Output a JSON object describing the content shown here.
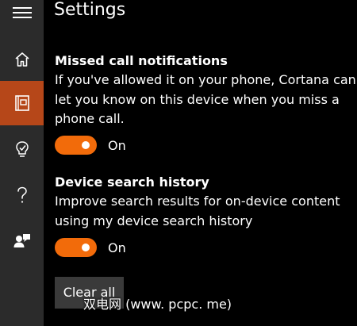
{
  "page": {
    "title": "Settings"
  },
  "nav": {
    "items": [
      {
        "name": "home",
        "icon": "home-icon",
        "active": false
      },
      {
        "name": "notebook",
        "icon": "notebook-icon",
        "active": true
      },
      {
        "name": "reminders",
        "icon": "lightbulb-icon",
        "active": false
      },
      {
        "name": "help",
        "icon": "question-icon",
        "active": false
      },
      {
        "name": "feedback",
        "icon": "feedback-icon",
        "active": false
      }
    ]
  },
  "settings": {
    "missed_calls": {
      "heading": "Missed call notifications",
      "description_lines": [
        "If you've allowed it on your phone, Cortana can",
        "let you know on this device when you miss a",
        "phone call."
      ],
      "toggle_on": true,
      "toggle_label": "On"
    },
    "search_history": {
      "heading": "Device search history",
      "description_lines": [
        "Improve search results for on-device content",
        "using my device search history"
      ],
      "toggle_on": true,
      "toggle_label": "On",
      "clear_button_label": "Clear all"
    }
  },
  "watermark": {
    "text": "双电网 (www. pcpc. me)"
  },
  "colors": {
    "accent": "#f26b0a",
    "active_nav": "#b64719",
    "rail_background": "#2b2b2b",
    "page_background": "#000000"
  }
}
